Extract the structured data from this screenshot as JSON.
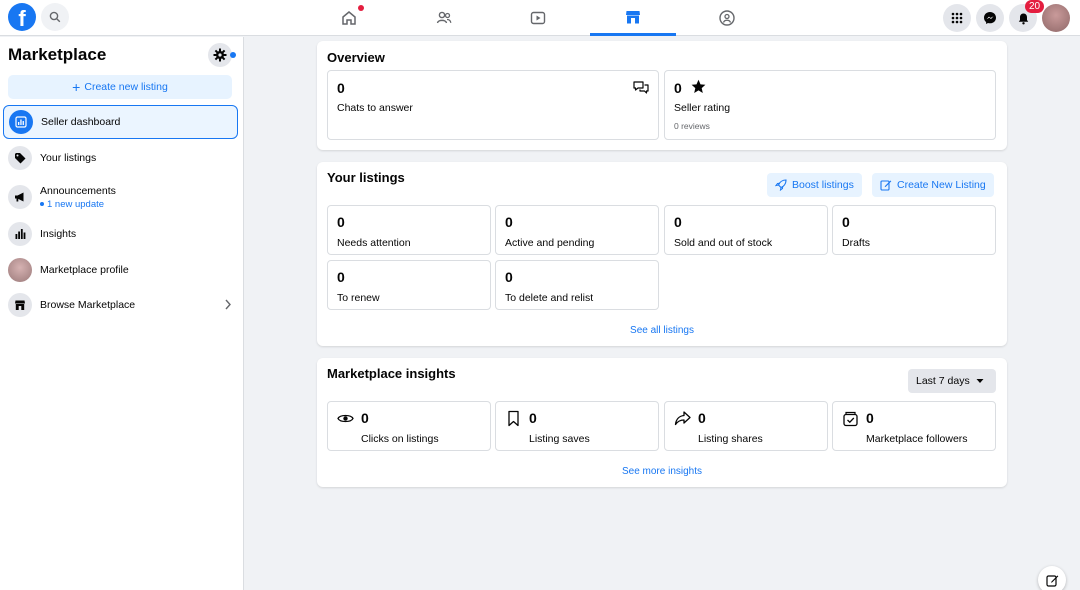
{
  "app": {
    "logo_letter": "f"
  },
  "topnav": {
    "tabs": [
      "home",
      "friends",
      "watch",
      "marketplace",
      "groups"
    ],
    "notification_count": "20"
  },
  "sidebar": {
    "title": "Marketplace",
    "create_label": "Create new listing",
    "items": [
      {
        "label": "Seller dashboard"
      },
      {
        "label": "Your listings"
      },
      {
        "label": "Announcements",
        "sub": "1 new update"
      },
      {
        "label": "Insights"
      },
      {
        "label": "Marketplace profile"
      },
      {
        "label": "Browse Marketplace"
      }
    ]
  },
  "overview": {
    "title": "Overview",
    "chats": {
      "value": "0",
      "label": "Chats to answer"
    },
    "rating": {
      "value": "0",
      "label": "Seller rating",
      "sub": "0 reviews"
    }
  },
  "listings": {
    "title": "Your listings",
    "boost_label": "Boost listings",
    "create_label": "Create New Listing",
    "stats": [
      {
        "value": "0",
        "label": "Needs attention"
      },
      {
        "value": "0",
        "label": "Active and pending"
      },
      {
        "value": "0",
        "label": "Sold and out of stock"
      },
      {
        "value": "0",
        "label": "Drafts"
      },
      {
        "value": "0",
        "label": "To renew"
      },
      {
        "value": "0",
        "label": "To delete and relist"
      }
    ],
    "see_all": "See all listings"
  },
  "insights": {
    "title": "Marketplace insights",
    "range": "Last 7 days",
    "stats": [
      {
        "value": "0",
        "label": "Clicks on listings",
        "icon": "eye-icon"
      },
      {
        "value": "0",
        "label": "Listing saves",
        "icon": "bookmark-icon"
      },
      {
        "value": "0",
        "label": "Listing shares",
        "icon": "share-icon"
      },
      {
        "value": "0",
        "label": "Marketplace followers",
        "icon": "followers-icon"
      }
    ],
    "see_more": "See more insights"
  },
  "colors": {
    "accent": "#1877f2",
    "background": "#f0f2f5",
    "badge": "#e41e3f"
  }
}
